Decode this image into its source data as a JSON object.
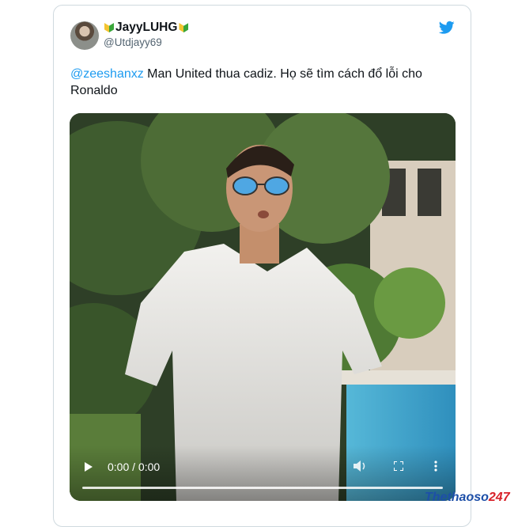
{
  "tweet": {
    "display_name": "JayyLUHG",
    "handle": "@Utdjayy69",
    "mention": "@zeeshanxz",
    "text": " Man United thua cadiz. Họ sẽ tìm cách đổ lỗi cho Ronaldo"
  },
  "video": {
    "time": "0:00 / 0:00",
    "progress": 0
  },
  "watermark": {
    "part1": "Thethaoso",
    "part2": "247"
  },
  "colors": {
    "link": "#1d9bf0",
    "twitter_blue": "#1d9bf0",
    "watermark_blue": "#1d4fa8",
    "watermark_red": "#d8222a"
  },
  "icons": [
    "twitter-bird-icon",
    "play-icon",
    "volume-icon",
    "fullscreen-icon",
    "more-options-icon"
  ]
}
